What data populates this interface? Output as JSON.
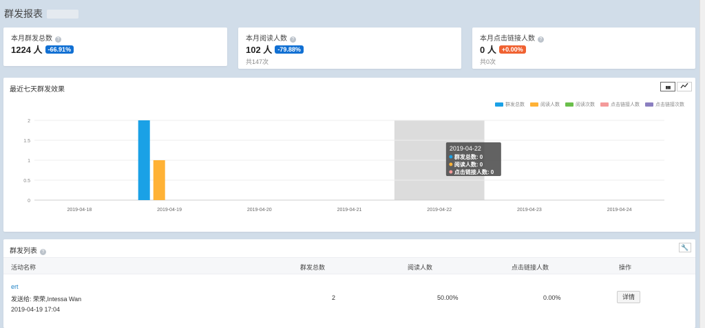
{
  "page": {
    "title": "群发报表"
  },
  "stats": [
    {
      "label": "本月群发总数",
      "value": "1224 人",
      "badge": "-66.91%",
      "sub": ""
    },
    {
      "label": "本月阅读人数",
      "value": "102 人",
      "badge": "-79.88%",
      "sub": "共147次"
    },
    {
      "label": "本月点击链接人数",
      "value": "0 人",
      "badge": "+0.00%",
      "sub": "共0次"
    }
  ],
  "chart": {
    "title": "最近七天群发效果",
    "toggle_bar": "▮▮▮",
    "toggle_line": "📈",
    "tooltip": {
      "date": "2019-04-22",
      "lines": [
        "群发总数: 0",
        "阅读人数: 0",
        "点击链接人数: 0"
      ]
    }
  },
  "chart_data": {
    "type": "bar",
    "categories": [
      "2019-04-18",
      "2019-04-19",
      "2019-04-20",
      "2019-04-21",
      "2019-04-22",
      "2019-04-23",
      "2019-04-24"
    ],
    "series": [
      {
        "name": "群发总数",
        "values": [
          0,
          2,
          0,
          0,
          0,
          0,
          0
        ],
        "color": "#1aa1e6"
      },
      {
        "name": "阅读人数",
        "values": [
          0,
          1,
          0,
          0,
          0,
          0,
          0
        ],
        "color": "#ffb236"
      },
      {
        "name": "阅读次数",
        "values": [
          0,
          0,
          0,
          0,
          0,
          0,
          0
        ],
        "color": "#6abf4b"
      },
      {
        "name": "点击链接人数",
        "values": [
          0,
          0,
          0,
          0,
          0,
          0,
          0
        ],
        "color": "#f49a9a"
      },
      {
        "name": "点击链接次数",
        "values": [
          0,
          0,
          0,
          0,
          0,
          0,
          0
        ],
        "color": "#8b7fc0"
      }
    ],
    "yticks": [
      "0",
      "0.5",
      "1",
      "1.5",
      "2"
    ],
    "ylim": [
      0,
      2
    ],
    "highlight_category": "2019-04-22",
    "legend_position": "top-right",
    "grid": true
  },
  "list": {
    "title": "群发列表",
    "columns": [
      "活动名称",
      "群发总数",
      "阅读人数",
      "点击链接人数",
      "操作"
    ],
    "rows": [
      {
        "name": "ert",
        "recipients": "发送给: 荣荣,Intessa Wan",
        "time": "2019-04-19 17:04",
        "total": "2",
        "read": "50.00%",
        "click": "0.00%",
        "action": "详情"
      }
    ]
  }
}
